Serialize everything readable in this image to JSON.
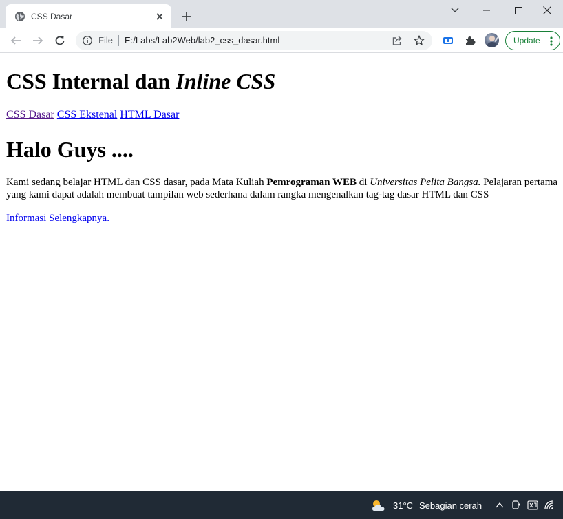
{
  "browser": {
    "tab": {
      "title": "CSS Dasar",
      "favicon": "globe-icon",
      "close_icon": "close-icon"
    },
    "new_tab_icon": "plus-icon",
    "window_controls": [
      "chevron-down-icon",
      "minimize-icon",
      "maximize-icon",
      "close-icon"
    ],
    "toolbar": {
      "back_icon": "back-arrow-icon",
      "forward_icon": "forward-arrow-icon",
      "reload_icon": "reload-icon",
      "omnibox": {
        "info_icon": "info-icon",
        "scheme_label": "File",
        "url": "E:/Labs/Lab2Web/lab2_css_dasar.html",
        "share_icon": "share-icon",
        "bookmark_icon": "star-icon"
      },
      "extension_icons": [
        "screencast-icon",
        "puzzle-icon"
      ],
      "update_label": "Update",
      "menu_icon": "kebab-menu-icon"
    }
  },
  "page": {
    "heading": {
      "part1": "CSS Internal dan ",
      "part2_italic": "Inline CSS"
    },
    "nav_links": [
      {
        "label": "CSS Dasar",
        "visited": true
      },
      {
        "label": "CSS Ekstenal",
        "visited": false
      },
      {
        "label": "HTML Dasar",
        "visited": false
      }
    ],
    "subheading": "Halo Guys ....",
    "paragraph": {
      "text1": "Kami sedang belajar HTML dan CSS dasar, pada Mata Kuliah ",
      "bold": "Pemrograman WEB",
      "text2": " di ",
      "italic": "Universitas Pelita Bangsa.",
      "text3": " Pelajaran pertama yang kami dapat adalah membuat tampilan web sederhana dalam rangka mengenalkan tag-tag dasar HTML dan CSS"
    },
    "more_link": "Informasi Selengkapnya."
  },
  "taskbar": {
    "weather_icon": "partly-cloudy-icon",
    "temperature": "31°C",
    "condition": "Sebagian cerah",
    "tray_icons": [
      "chevron-up-icon",
      "meet-now-icon",
      "language-icon",
      "wifi-icon"
    ]
  },
  "colors": {
    "tabstrip_bg": "#dee1e6",
    "omnibox_bg": "#f1f3f4",
    "update_green": "#188038",
    "link": "#0000ee",
    "link_visited": "#551a8b",
    "taskbar_bg": "#202a35"
  }
}
